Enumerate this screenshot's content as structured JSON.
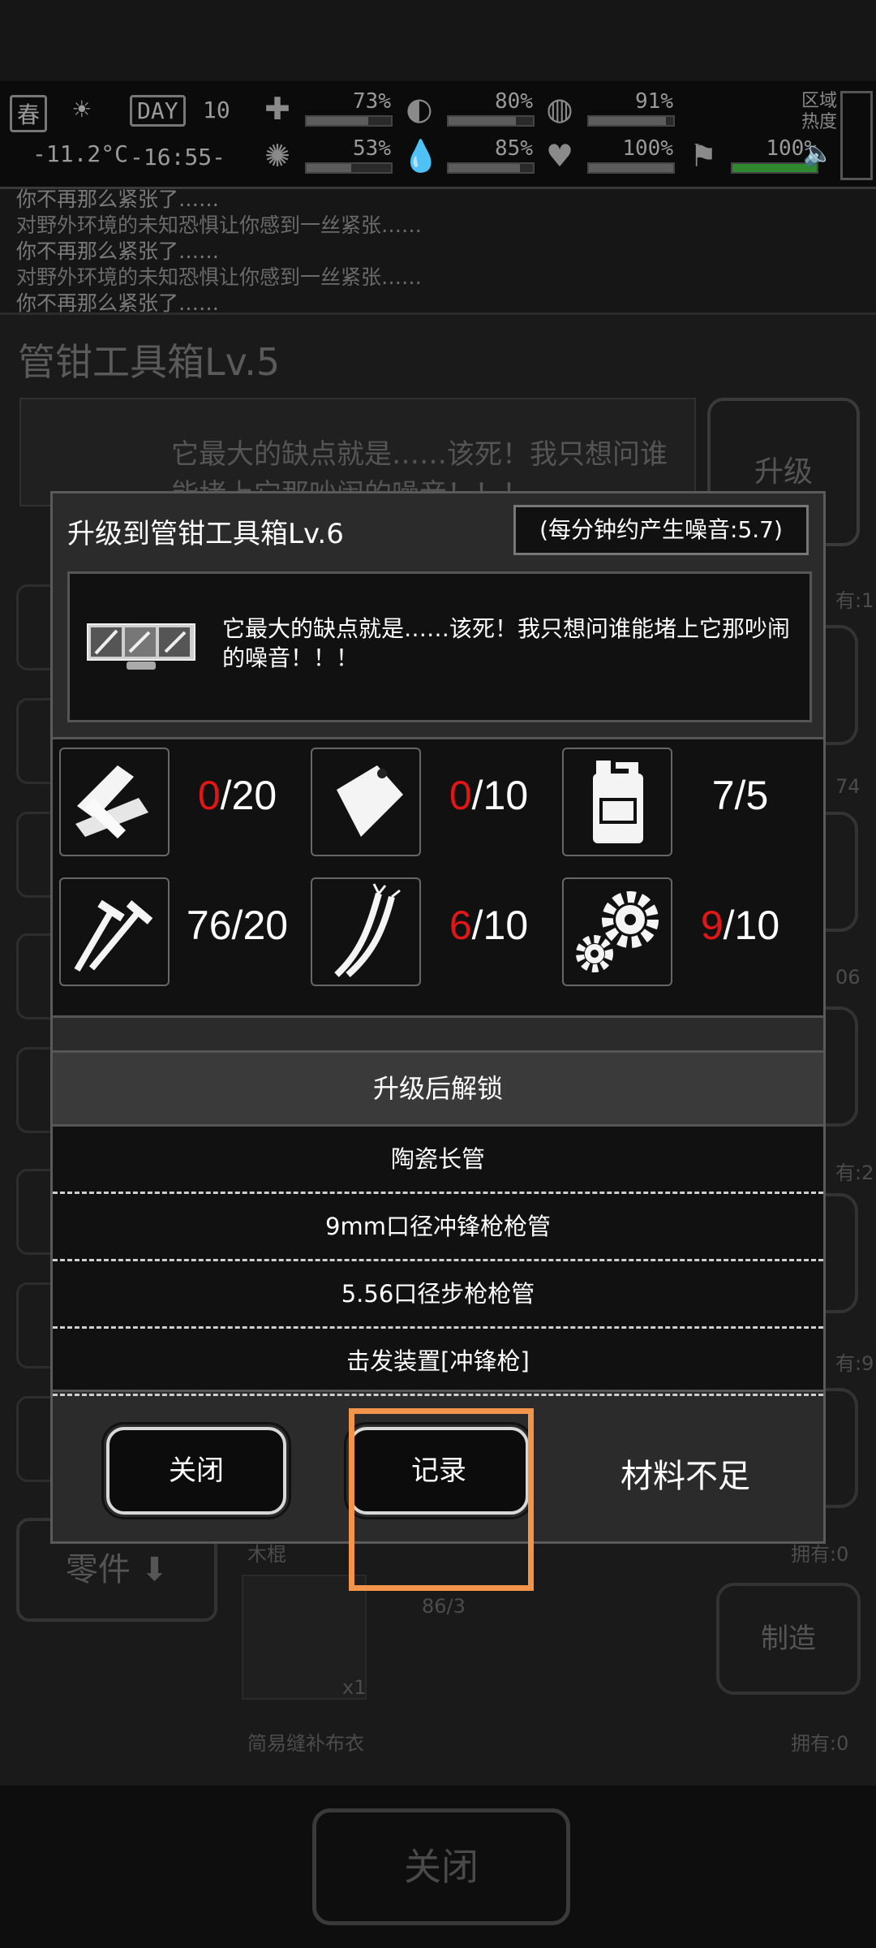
{
  "status_bar": {
    "season": "春",
    "day_label": "DAY",
    "day_value": "10",
    "temperature": "-11.2°C",
    "clock": "-16:55-",
    "stats": [
      {
        "icon": "medkit-icon",
        "value": "73%",
        "level": 0.73
      },
      {
        "icon": "stomach-icon",
        "value": "80%",
        "level": 0.8
      },
      {
        "icon": "lungs-icon",
        "value": "91%",
        "level": 0.91
      },
      {
        "icon": "brain-icon",
        "value": "53%",
        "level": 0.53
      },
      {
        "icon": "water-drop-icon",
        "value": "85%",
        "level": 0.85
      },
      {
        "icon": "heart-icon",
        "value": "100%",
        "level": 1.0
      },
      {
        "icon": "stamina-icon",
        "value": "100%",
        "level": 1.0
      }
    ],
    "region_label": "区域\n热度"
  },
  "background": {
    "log_lines": [
      "你不再那么紧张了……",
      "对野外环境的未知恐惧让你感到一丝紧张……",
      "你不再那么紧张了……",
      "对野外环境的未知恐惧让你感到一丝紧张……",
      "你不再那么紧张了……"
    ],
    "panel_title": "管钳工具箱Lv.5",
    "panel_desc": "它最大的缺点就是……该死！我只想问谁能堵上它那吵闹的噪音！！！",
    "upgrade_label": "升级",
    "owned_1": "有:1",
    "owned_74": "74",
    "owned_06": "06",
    "owned_2": "有:2",
    "owned_9": "有:9",
    "parts_label": "零件",
    "item_name_1": "木棍",
    "item_owned_0": "拥有:0",
    "item_qty": "86/3",
    "item_x1": "x1",
    "make_label": "制造",
    "item_name_2": "简易缝补布衣",
    "item_owned_0b": "拥有:0",
    "close_label": "关闭"
  },
  "modal": {
    "title": "升级到管钳工具箱Lv.6",
    "noise": "(每分钟约产生噪音:5.7)",
    "description": "它最大的缺点就是……该死！我只想问谁能堵上它那吵闹的噪音！！！",
    "materials": [
      {
        "icon": "wood-planks-icon",
        "have": "0",
        "need": "/20",
        "low": true
      },
      {
        "icon": "plastic-bag-icon",
        "have": "0",
        "need": "/10",
        "low": true
      },
      {
        "icon": "fuel-jerrycan-icon",
        "have": "7",
        "need": "/5",
        "low": false
      },
      {
        "icon": "screws-icon",
        "have": "76",
        "need": "/20",
        "low": false
      },
      {
        "icon": "wires-icon",
        "have": "6",
        "need": "/10",
        "low": true
      },
      {
        "icon": "gears-icon",
        "have": "9",
        "need": "/10",
        "low": true
      }
    ],
    "unlock_header": "升级后解锁",
    "unlocks": [
      "陶瓷长管",
      "9mm口径冲锋枪枪管",
      "5.56口径步枪枪管",
      "击发装置[冲锋枪]"
    ],
    "close_button": "关闭",
    "record_button": "记录",
    "insufficient": "材料不足"
  }
}
